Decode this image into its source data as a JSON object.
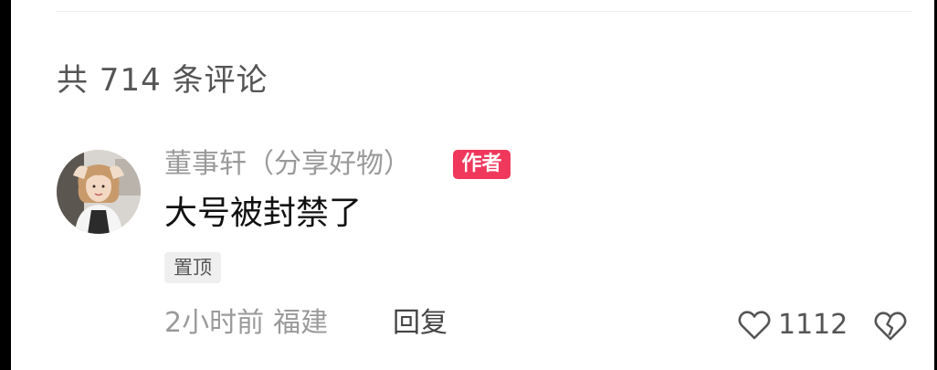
{
  "comments_header": {
    "count_label": "共 714 条评论"
  },
  "comment": {
    "username": "董事轩（分享好物）",
    "author_badge": "作者",
    "text": "大号被封禁了",
    "pinned_label": "置顶",
    "time": "2小时前",
    "location": "福建",
    "reply_label": "回复",
    "like_count": "1112",
    "avatar_icon": "avatar-photo",
    "like_icon": "heart-outline-icon",
    "dislike_icon": "broken-heart-icon"
  },
  "colors": {
    "badge": "#f0385c",
    "muted_text": "#9a9a9a",
    "body_text": "#111111"
  }
}
